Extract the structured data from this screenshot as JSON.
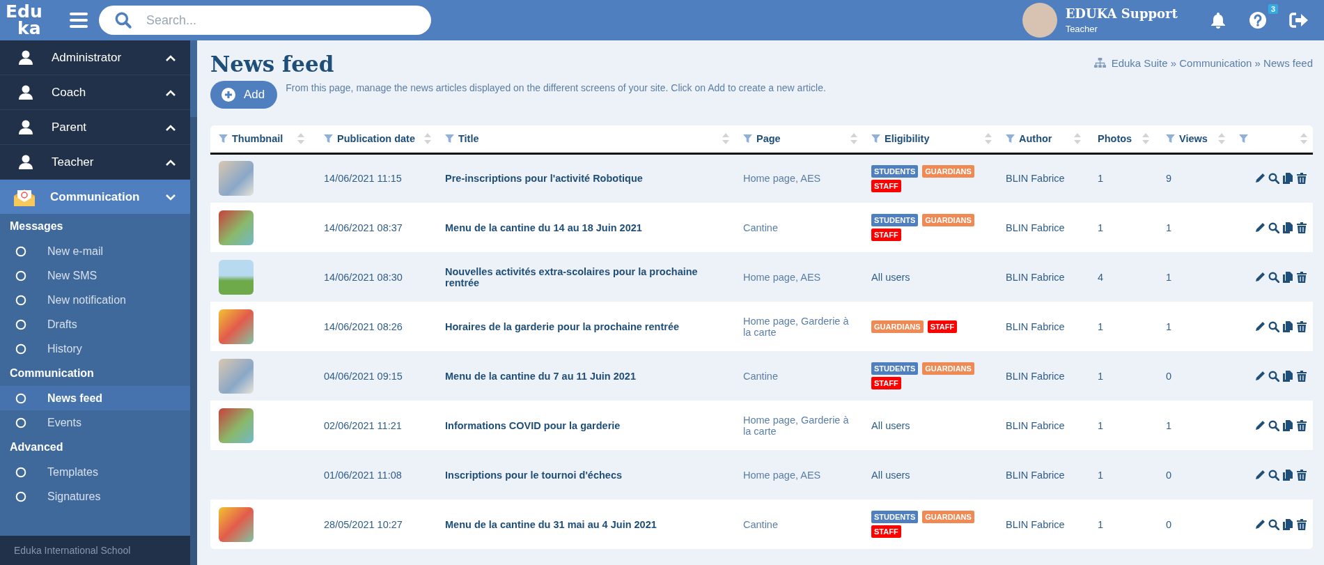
{
  "header": {
    "logo": [
      "Edu",
      "ka"
    ],
    "search": {
      "placeholder": "Search..."
    },
    "user": {
      "name": "EDUKA Support",
      "role": "Teacher"
    },
    "help_badge": "3"
  },
  "sidebar": {
    "menus": [
      {
        "label": "Administrator",
        "kind": "role",
        "expanded": false
      },
      {
        "label": "Coach",
        "kind": "role",
        "expanded": false
      },
      {
        "label": "Parent",
        "kind": "role",
        "expanded": false
      },
      {
        "label": "Teacher",
        "kind": "role",
        "expanded": false
      },
      {
        "label": "Communication",
        "kind": "module",
        "expanded": true,
        "groups": [
          {
            "heading": "Messages",
            "items": [
              {
                "label": "New e-mail",
                "selected": false
              },
              {
                "label": "New SMS",
                "selected": false
              },
              {
                "label": "New notification",
                "selected": false
              },
              {
                "label": "Drafts",
                "selected": false
              },
              {
                "label": "History",
                "selected": false
              }
            ]
          },
          {
            "heading": "Communication",
            "items": [
              {
                "label": "News feed",
                "selected": true
              },
              {
                "label": "Events",
                "selected": false
              }
            ]
          },
          {
            "heading": "Advanced",
            "items": [
              {
                "label": "Templates",
                "selected": false
              },
              {
                "label": "Signatures",
                "selected": false
              }
            ]
          }
        ]
      }
    ],
    "footer": "Eduka International School"
  },
  "page": {
    "title": "News feed",
    "breadcrumb": "Eduka Suite » Communication » News feed",
    "add_button": "Add",
    "description": "From this page, manage the news articles displayed on the different screens of your site. Click on Add to create a new article."
  },
  "table": {
    "columns": [
      {
        "label": "Thumbnail",
        "filter": true
      },
      {
        "label": "Publication date",
        "filter": true
      },
      {
        "label": "Title",
        "filter": true
      },
      {
        "label": "Page",
        "filter": true
      },
      {
        "label": "Eligibility",
        "filter": true
      },
      {
        "label": "Author",
        "filter": true
      },
      {
        "label": "Photos",
        "filter": false
      },
      {
        "label": "Views",
        "filter": true
      },
      {
        "filter": true
      }
    ],
    "rows": [
      {
        "thumbnail": true,
        "date": "14/06/2021 11:15",
        "title": "Pre-inscriptions pour l'activité Robotique",
        "page": "Home page, AES",
        "eligibility": [
          {
            "label": "STUDENTS",
            "color": "#4f7fbf"
          },
          {
            "label": "GUARDIANS",
            "color": "#f08a55"
          },
          {
            "label": "STAFF",
            "color": "#ff0000"
          }
        ],
        "author": "BLIN Fabrice",
        "photos": "1",
        "views": "9"
      },
      {
        "thumbnail": true,
        "date": "14/06/2021 08:37",
        "title": "Menu de la cantine du 14 au 18 Juin 2021",
        "page": "Cantine",
        "eligibility": [
          {
            "label": "STUDENTS",
            "color": "#4f7fbf"
          },
          {
            "label": "GUARDIANS",
            "color": "#f08a55"
          },
          {
            "label": "STAFF",
            "color": "#ff0000"
          }
        ],
        "author": "BLIN Fabrice",
        "photos": "1",
        "views": "1"
      },
      {
        "thumbnail": true,
        "date": "14/06/2021 08:30",
        "title": "Nouvelles activités extra-scolaires pour la prochaine rentrée",
        "page": "Home page, AES",
        "eligibility": "All users",
        "author": "BLIN Fabrice",
        "photos": "4",
        "views": "1"
      },
      {
        "thumbnail": true,
        "date": "14/06/2021 08:26",
        "title": "Horaires de la garderie pour la prochaine rentrée",
        "page": "Home page, Garderie à la carte",
        "eligibility": [
          {
            "label": "GUARDIANS",
            "color": "#f08a55"
          },
          {
            "label": "STAFF",
            "color": "#ff0000"
          }
        ],
        "author": "BLIN Fabrice",
        "photos": "1",
        "views": "1"
      },
      {
        "thumbnail": true,
        "date": "04/06/2021 09:15",
        "title": "Menu de la cantine du 7 au 11 Juin 2021",
        "page": "Cantine",
        "eligibility": [
          {
            "label": "STUDENTS",
            "color": "#4f7fbf"
          },
          {
            "label": "GUARDIANS",
            "color": "#f08a55"
          },
          {
            "label": "STAFF",
            "color": "#ff0000"
          }
        ],
        "author": "BLIN Fabrice",
        "photos": "1",
        "views": "0"
      },
      {
        "thumbnail": true,
        "date": "02/06/2021 11:21",
        "title": "Informations COVID pour la garderie",
        "page": "Home page, Garderie à la carte",
        "eligibility": "All users",
        "author": "BLIN Fabrice",
        "photos": "1",
        "views": "1"
      },
      {
        "thumbnail": false,
        "date": "01/06/2021 11:08",
        "title": "Inscriptions pour le tournoi d'échecs",
        "page": "Home page, AES",
        "eligibility": "All users",
        "author": "BLIN Fabrice",
        "photos": "1",
        "views": "0"
      },
      {
        "thumbnail": true,
        "date": "28/05/2021 10:27",
        "title": "Menu de la cantine du 31 mai au 4 Juin 2021",
        "page": "Cantine",
        "eligibility": [
          {
            "label": "STUDENTS",
            "color": "#4f7fbf"
          },
          {
            "label": "GUARDIANS",
            "color": "#f08a55"
          },
          {
            "label": "STAFF",
            "color": "#ff0000"
          }
        ],
        "author": "BLIN Fabrice",
        "photos": "1",
        "views": "0"
      }
    ]
  }
}
